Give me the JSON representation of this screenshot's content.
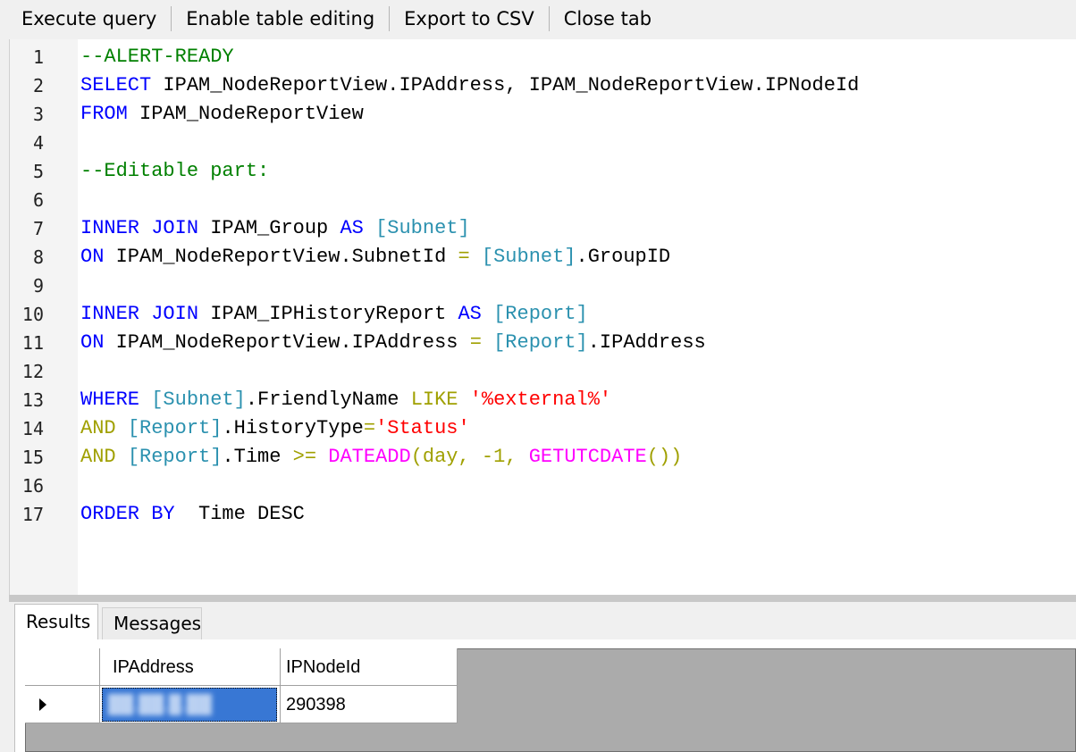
{
  "toolbar": {
    "execute": "Execute query",
    "enable_editing": "Enable table editing",
    "export_csv": "Export to CSV",
    "close_tab": "Close tab"
  },
  "editor": {
    "lines": [
      {
        "n": "1",
        "tokens": [
          {
            "t": "--ALERT-READY",
            "c": "cm"
          }
        ]
      },
      {
        "n": "2",
        "tokens": [
          {
            "t": "SELECT",
            "c": "kw"
          },
          {
            "t": " IPAM_NodeReportView.IPAddress, IPAM_NodeReportView.IPNodeId",
            "c": "nm"
          }
        ]
      },
      {
        "n": "3",
        "tokens": [
          {
            "t": "FROM",
            "c": "kw"
          },
          {
            "t": " IPAM_NodeReportView",
            "c": "nm"
          }
        ]
      },
      {
        "n": "4",
        "tokens": []
      },
      {
        "n": "5",
        "tokens": [
          {
            "t": "--Editable part:",
            "c": "cm"
          }
        ]
      },
      {
        "n": "6",
        "tokens": []
      },
      {
        "n": "7",
        "tokens": [
          {
            "t": "INNER JOIN",
            "c": "kw"
          },
          {
            "t": " IPAM_Group ",
            "c": "nm"
          },
          {
            "t": "AS",
            "c": "kw"
          },
          {
            "t": " ",
            "c": "nm"
          },
          {
            "t": "[Subnet]",
            "c": "br"
          }
        ]
      },
      {
        "n": "8",
        "tokens": [
          {
            "t": "ON",
            "c": "kw"
          },
          {
            "t": " IPAM_NodeReportView.SubnetId ",
            "c": "nm"
          },
          {
            "t": "=",
            "c": "op"
          },
          {
            "t": " ",
            "c": "nm"
          },
          {
            "t": "[Subnet]",
            "c": "br"
          },
          {
            "t": ".GroupID",
            "c": "nm"
          }
        ]
      },
      {
        "n": "9",
        "tokens": []
      },
      {
        "n": "10",
        "tokens": [
          {
            "t": "INNER JOIN",
            "c": "kw"
          },
          {
            "t": " IPAM_IPHistoryReport ",
            "c": "nm"
          },
          {
            "t": "AS",
            "c": "kw"
          },
          {
            "t": " ",
            "c": "nm"
          },
          {
            "t": "[Report]",
            "c": "br"
          }
        ]
      },
      {
        "n": "11",
        "tokens": [
          {
            "t": "ON",
            "c": "kw"
          },
          {
            "t": " IPAM_NodeReportView.IPAddress ",
            "c": "nm"
          },
          {
            "t": "=",
            "c": "op"
          },
          {
            "t": " ",
            "c": "nm"
          },
          {
            "t": "[Report]",
            "c": "br"
          },
          {
            "t": ".IPAddress",
            "c": "nm"
          }
        ]
      },
      {
        "n": "12",
        "tokens": []
      },
      {
        "n": "13",
        "tokens": [
          {
            "t": "WHERE",
            "c": "kw"
          },
          {
            "t": " ",
            "c": "nm"
          },
          {
            "t": "[Subnet]",
            "c": "br"
          },
          {
            "t": ".FriendlyName ",
            "c": "nm"
          },
          {
            "t": "LIKE",
            "c": "op"
          },
          {
            "t": " ",
            "c": "nm"
          },
          {
            "t": "'%external%'",
            "c": "st"
          }
        ]
      },
      {
        "n": "14",
        "tokens": [
          {
            "t": "AND",
            "c": "op"
          },
          {
            "t": " ",
            "c": "nm"
          },
          {
            "t": "[Report]",
            "c": "br"
          },
          {
            "t": ".HistoryType",
            "c": "nm"
          },
          {
            "t": "=",
            "c": "op"
          },
          {
            "t": "'Status'",
            "c": "st"
          }
        ]
      },
      {
        "n": "15",
        "tokens": [
          {
            "t": "AND",
            "c": "op"
          },
          {
            "t": " ",
            "c": "nm"
          },
          {
            "t": "[Report]",
            "c": "br"
          },
          {
            "t": ".Time ",
            "c": "nm"
          },
          {
            "t": ">=",
            "c": "op"
          },
          {
            "t": " ",
            "c": "nm"
          },
          {
            "t": "DATEADD",
            "c": "fn"
          },
          {
            "t": "(day, -1, ",
            "c": "op"
          },
          {
            "t": "GETUTCDATE",
            "c": "fn"
          },
          {
            "t": "())",
            "c": "op"
          }
        ]
      },
      {
        "n": "16",
        "tokens": []
      },
      {
        "n": "17",
        "tokens": [
          {
            "t": "ORDER BY",
            "c": "kw"
          },
          {
            "t": "  Time DESC",
            "c": "nm"
          }
        ]
      }
    ]
  },
  "tabs": {
    "results": "Results",
    "messages": "Messages"
  },
  "grid": {
    "columns": [
      "IPAddress",
      "IPNodeId"
    ],
    "rows": [
      {
        "ipaddress": "██.██.█.██",
        "ipnodeid": "290398"
      }
    ]
  },
  "colors": {
    "keyword": "#0000ff",
    "comment": "#008000",
    "string": "#ff0000",
    "function": "#ff00ff",
    "bracket": "#2b91af",
    "operator": "#a0a000",
    "selection": "#3877d4"
  }
}
